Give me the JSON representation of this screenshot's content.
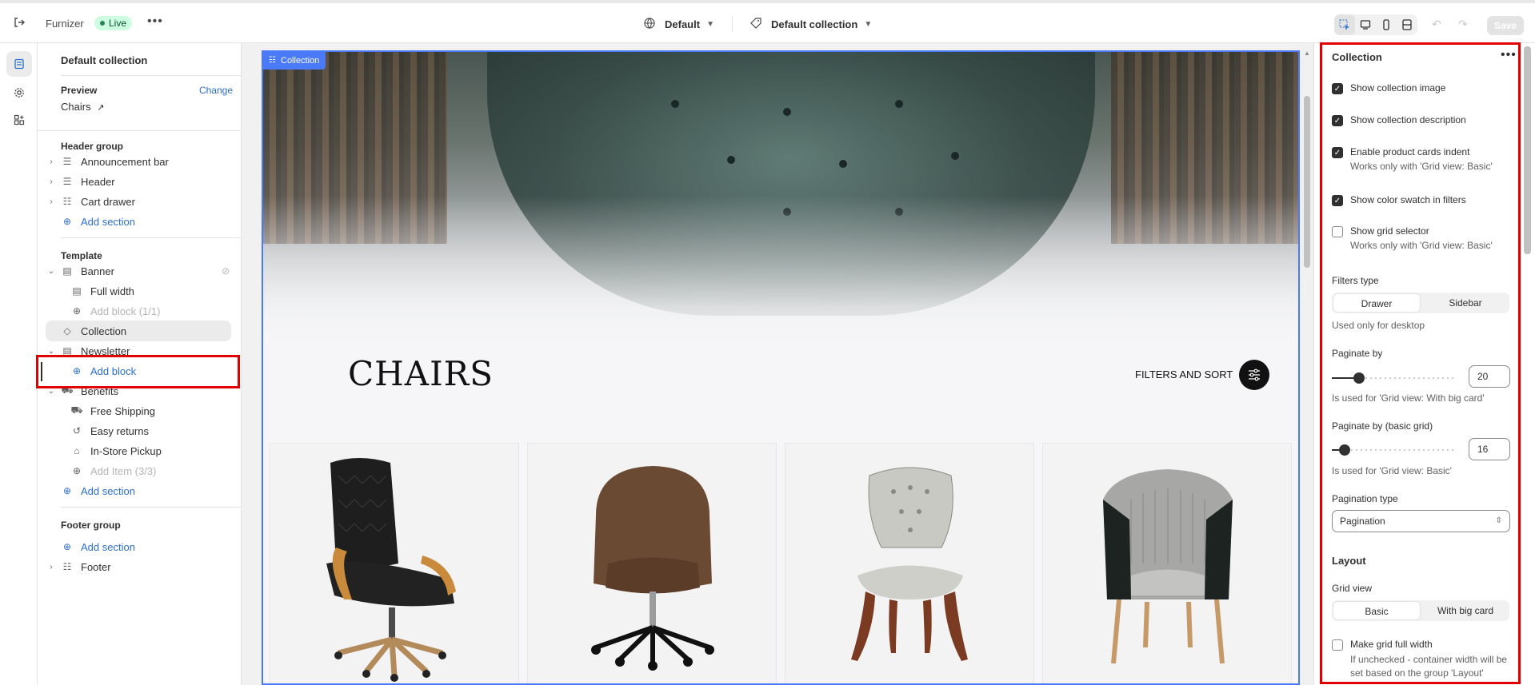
{
  "topbar": {
    "store_name": "Furnizer",
    "status_badge": "Live",
    "more": "•••",
    "theme_selector": "Default",
    "template_selector": "Default collection"
  },
  "left_panel": {
    "title": "Default collection",
    "preview_label": "Preview",
    "change_link": "Change",
    "preview_value": "Chairs",
    "header_group": {
      "title": "Header group",
      "items": [
        "Announcement bar",
        "Header",
        "Cart drawer"
      ],
      "add_section": "Add section"
    },
    "template": {
      "title": "Template",
      "banner": "Banner",
      "banner_blocks": [
        "Full width"
      ],
      "banner_add_block": "Add block (1/1)",
      "collection": "Collection",
      "newsletter": "Newsletter",
      "newsletter_add_block": "Add block",
      "benefits": "Benefits",
      "benefits_items": [
        "Free Shipping",
        "Easy returns",
        "In-Store Pickup"
      ],
      "benefits_add_item": "Add Item (3/3)",
      "add_section": "Add section"
    },
    "footer_group": {
      "title": "Footer group",
      "add_section": "Add section",
      "items": [
        "Footer"
      ]
    }
  },
  "preview": {
    "section_tag": "Collection",
    "collection_title": "CHAIRS",
    "filters_label": "FILTERS AND SORT",
    "product_cards": [
      "black-leather-office-chair",
      "brown-leather-swivel-chair",
      "tufted-grey-dining-chair",
      "grey-black-armchair"
    ]
  },
  "settings": {
    "title": "Collection",
    "checkboxes": [
      {
        "label": "Show collection image",
        "checked": true,
        "help": ""
      },
      {
        "label": "Show collection description",
        "checked": true,
        "help": ""
      },
      {
        "label": "Enable product cards indent",
        "checked": true,
        "help": "Works only with 'Grid view: Basic'"
      },
      {
        "label": "Show color swatch in filters",
        "checked": true,
        "help": ""
      },
      {
        "label": "Show grid selector",
        "checked": false,
        "help": "Works only with 'Grid view: Basic'"
      }
    ],
    "filters_type": {
      "label": "Filters type",
      "options": [
        "Drawer",
        "Sidebar"
      ],
      "selected": "Drawer",
      "help": "Used only for desktop"
    },
    "paginate_by": {
      "label": "Paginate by",
      "value": "20",
      "fraction": 0.22,
      "help": "Is used for 'Grid view: With big card'"
    },
    "paginate_by_basic": {
      "label": "Paginate by (basic grid)",
      "value": "16",
      "fraction": 0.1,
      "help": "Is used for 'Grid view: Basic'"
    },
    "pagination_type": {
      "label": "Pagination type",
      "value": "Pagination"
    },
    "layout": {
      "heading": "Layout",
      "grid_view": {
        "label": "Grid view",
        "options": [
          "Basic",
          "With big card"
        ],
        "selected": "Basic"
      },
      "full_width": {
        "label": "Make grid full width",
        "checked": false,
        "help": "If unchecked - container width will be set based on the group 'Layout'"
      }
    }
  },
  "actions": {
    "save": "Save"
  }
}
